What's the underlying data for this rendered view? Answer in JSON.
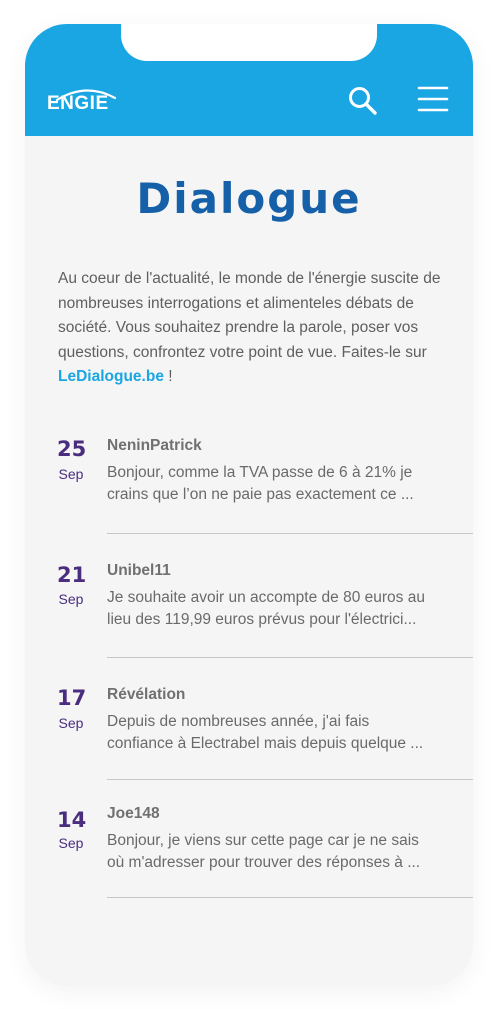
{
  "header": {
    "logo_text": "ENGIE",
    "brand_color": "#1aa6e3"
  },
  "page": {
    "title": "Dialogue",
    "intro": "Au coeur de l'actualité, le monde de l'énergie suscite de nombreuses interrogations et alimenteles débats de société. Vous souhaitez prendre la parole, poser vos questions, confrontez votre point de vue. Faites-le sur",
    "intro_link": "LeDialogue.be",
    "intro_end": " !"
  },
  "posts": [
    {
      "day": "25",
      "month": "Sep",
      "author": "NeninPatrick",
      "line1": "Bonjour, comme la TVA passe de 6 à 21% je",
      "line2": "crains que l’on ne paie pas exactement ce ..."
    },
    {
      "day": "21",
      "month": "Sep",
      "author": "Unibel11",
      "line1": "Je souhaite avoir un accompte de 80 euros au",
      "line2": "lieu des 119,99 euros prévus pour l'électrici..."
    },
    {
      "day": "17",
      "month": "Sep",
      "author": "Révélation",
      "line1": "Depuis de nombreuses année, j'ai fais",
      "line2": "confiance à Electrabel mais depuis quelque ..."
    },
    {
      "day": "14",
      "month": "Sep",
      "author": "Joe148",
      "line1": "Bonjour, je viens sur cette page car je ne sais",
      "line2": "où m'adresser pour trouver des réponses à ..."
    }
  ],
  "icons": {
    "search": "search-icon",
    "menu": "hamburger-menu-icon"
  }
}
